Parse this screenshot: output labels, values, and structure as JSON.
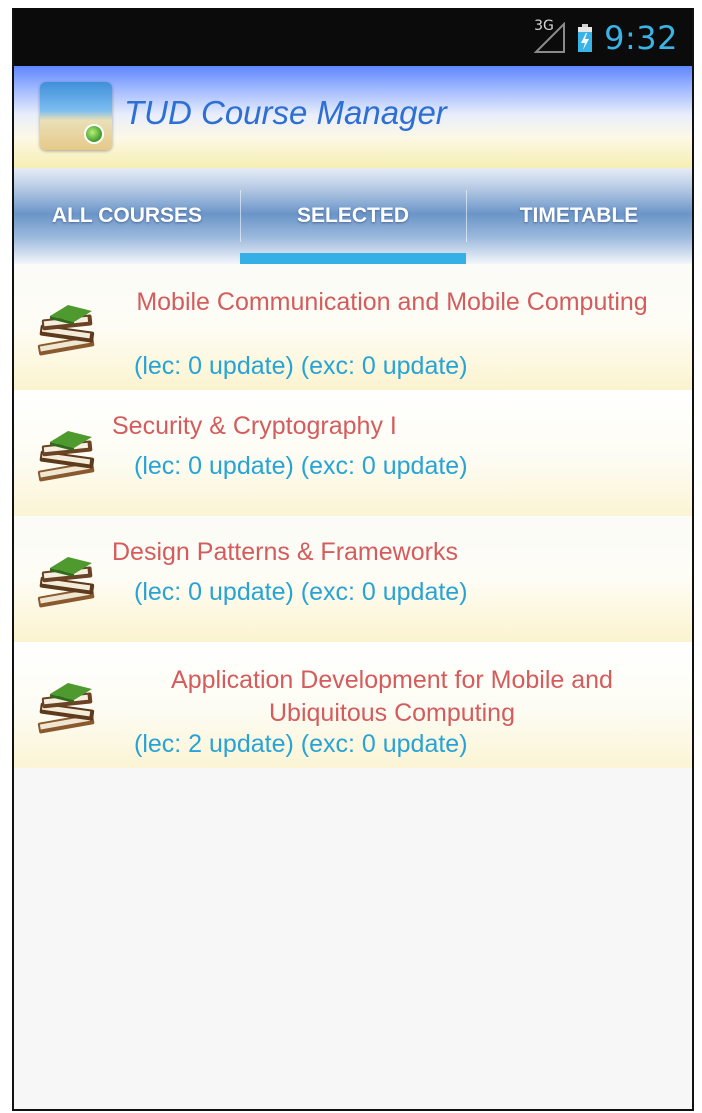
{
  "status_bar": {
    "network": "3G",
    "time": "9:32"
  },
  "action_bar": {
    "title": "TUD Course Manager"
  },
  "tabs": [
    {
      "label": "ALL COURSES",
      "selected": false
    },
    {
      "label": "SELECTED",
      "selected": true
    },
    {
      "label": "TIMETABLE",
      "selected": false
    }
  ],
  "courses": [
    {
      "name": "Mobile Communication and Mobile Computing",
      "updates": "(lec: 0 update) (exc: 0 update)",
      "icon": "books-icon"
    },
    {
      "name": "Security & Cryptography I",
      "updates": "(lec: 0 update) (exc: 0 update)",
      "icon": "books-icon"
    },
    {
      "name": "Design Patterns & Frameworks",
      "updates": "(lec: 0 update) (exc: 0 update)",
      "icon": "books-icon"
    },
    {
      "name": "Application Development for Mobile and Ubiquitous Computing",
      "updates": "(lec: 2 update) (exc: 0 update)",
      "icon": "books-icon"
    }
  ],
  "colors": {
    "accent": "#35b0e6",
    "course_name": "#d45c5c",
    "course_updates": "#27a3d6",
    "title": "#2d6fd2"
  }
}
